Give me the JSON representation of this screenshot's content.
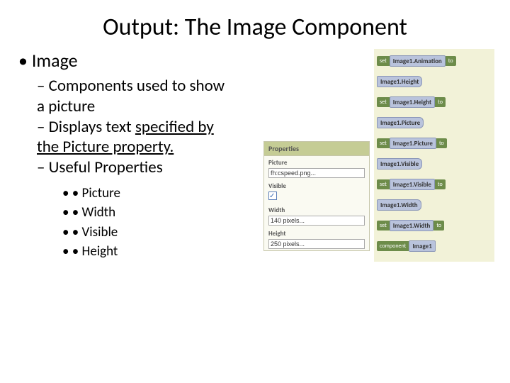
{
  "title": "Output: The Image Component",
  "main_bullet": "Image",
  "sub_bullets": {
    "b1": "Components used to show a picture",
    "b2_prefix": "Displays text ",
    "b2_underline": "specified by the Picture property.",
    "b3": "Useful Properties"
  },
  "props_list": [
    "Picture",
    "Width",
    "Visible",
    "Height"
  ],
  "properties_panel": {
    "header": "Properties",
    "rows": {
      "picture": {
        "label": "Picture",
        "value": "fh:cspeed.png..."
      },
      "visible": {
        "label": "Visible",
        "checked": true
      },
      "width": {
        "label": "Width",
        "value": "140 pixels..."
      },
      "height": {
        "label": "Height",
        "value": "250 pixels..."
      }
    }
  },
  "blocks": [
    {
      "kind": "set",
      "left": "set",
      "label": "Image1.Animation",
      "right": "to"
    },
    {
      "kind": "get",
      "label": "Image1.Height"
    },
    {
      "kind": "set",
      "left": "set",
      "label": "Image1.Height",
      "right": "to"
    },
    {
      "kind": "get",
      "label": "Image1.Picture"
    },
    {
      "kind": "set",
      "left": "set",
      "label": "Image1.Picture",
      "right": "to"
    },
    {
      "kind": "get",
      "label": "Image1.Visible"
    },
    {
      "kind": "set",
      "left": "set",
      "label": "Image1.Visible",
      "right": "to"
    },
    {
      "kind": "get",
      "label": "Image1.Width"
    },
    {
      "kind": "set",
      "left": "set",
      "label": "Image1.Width",
      "right": "to"
    },
    {
      "kind": "comp",
      "left": "component",
      "label": "Image1"
    }
  ]
}
